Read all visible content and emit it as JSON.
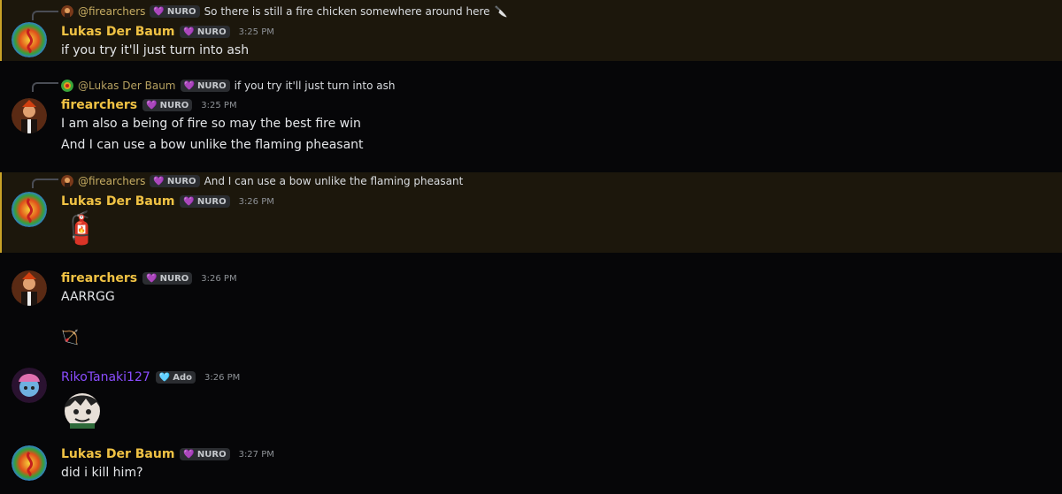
{
  "messages": [
    {
      "reply": {
        "name": "@firearchers",
        "badge": "NURO",
        "text": "So there is still a fire chicken somewhere around here",
        "emoji": "🔪"
      },
      "author": "Lukas Der Baum",
      "badge": "NURO",
      "time": "3:25 PM",
      "lines": [
        "if you try it'll just turn into ash"
      ]
    },
    {
      "reply": {
        "name": "@Lukas Der Baum",
        "badge": "NURO",
        "text": "if you try it'll just turn into ash"
      },
      "author": "firearchers",
      "badge": "NURO",
      "time": "3:25 PM",
      "lines": [
        "I am also a being of fire so may the best fire win",
        "And I can use a bow unlike the flaming pheasant"
      ]
    },
    {
      "reply": {
        "name": "@firearchers",
        "badge": "NURO",
        "text": "And I can use a bow unlike the flaming pheasant"
      },
      "author": "Lukas Der Baum",
      "badge": "NURO",
      "time": "3:26 PM",
      "emoji": "🧯"
    },
    {
      "author": "firearchers",
      "badge": "NURO",
      "time": "3:26 PM",
      "lines": [
        "AARRGG"
      ],
      "emoji": "🏹"
    },
    {
      "author": "RikoTanaki127",
      "badge": "Ado",
      "time": "3:26 PM"
    },
    {
      "author": "Lukas Der Baum",
      "badge": "NURO",
      "time": "3:27 PM",
      "lines": [
        "did i kill him?"
      ]
    }
  ],
  "icons": {
    "heart": "💜",
    "heart_cyan": "🩵"
  }
}
